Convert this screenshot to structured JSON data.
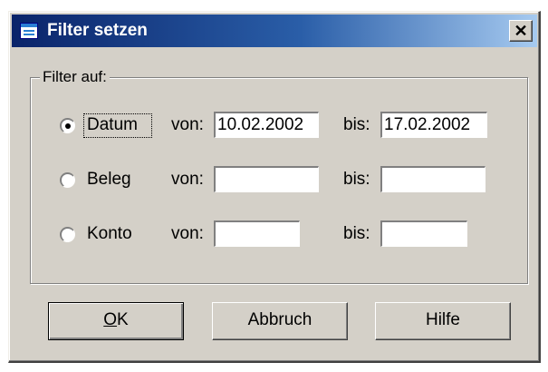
{
  "window": {
    "title": "Filter setzen",
    "close_glyph": "✕",
    "title_icon": "form-icon",
    "close_icon": "close-icon"
  },
  "group": {
    "label": "Filter auf:"
  },
  "rows": [
    {
      "option": "Datum",
      "selected": true,
      "from_label": "von:",
      "from_value": "10.02.2002",
      "to_label": "bis:",
      "to_value": "17.02.2002"
    },
    {
      "option": "Beleg",
      "selected": false,
      "from_label": "von:",
      "from_value": "",
      "to_label": "bis:",
      "to_value": ""
    },
    {
      "option": "Konto",
      "selected": false,
      "from_label": "von:",
      "from_value": "",
      "to_label": "bis:",
      "to_value": ""
    }
  ],
  "buttons": {
    "ok_mnemonic": "O",
    "ok_rest": "K",
    "cancel": "Abbruch",
    "help": "Hilfe"
  },
  "colors": {
    "title_start": "#0a246a",
    "title_end": "#a6caf0",
    "face": "#d4d0c8"
  }
}
